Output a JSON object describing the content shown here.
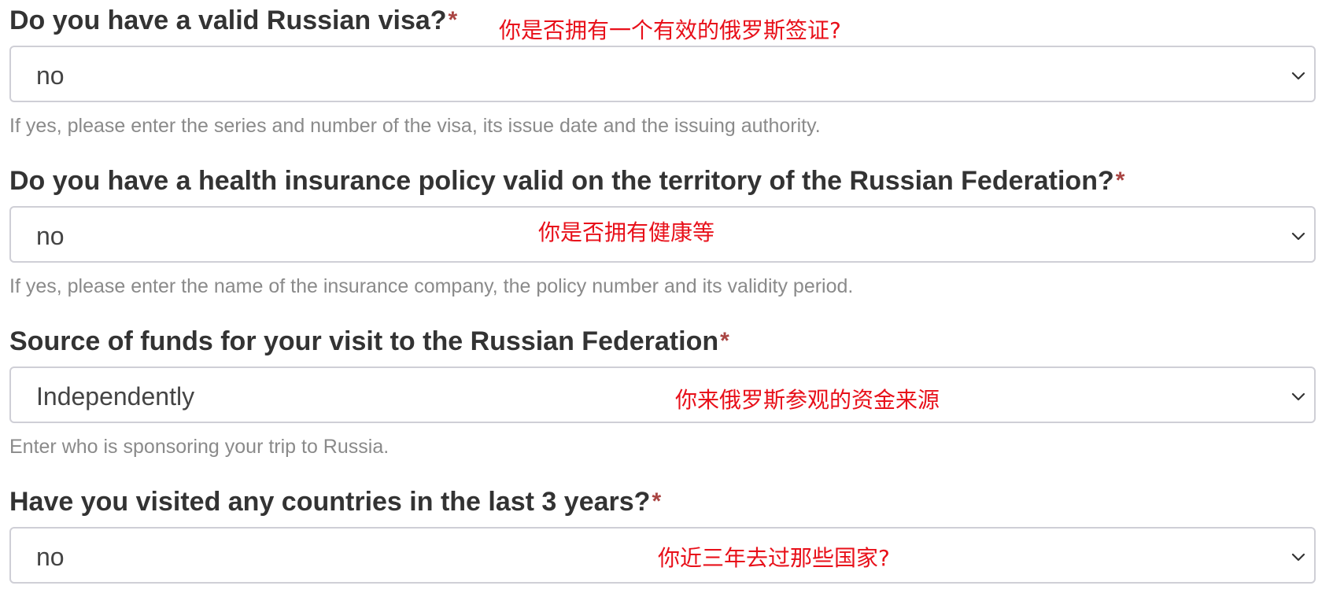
{
  "form": {
    "fields": [
      {
        "question": "Do you have a valid Russian visa?",
        "required_mark": "*",
        "selected": "no",
        "help": "If yes, please enter the series and number of the visa, its issue date and the issuing authority.",
        "annotation": "你是否拥有一个有效的俄罗斯签证?"
      },
      {
        "question": "Do you have a health insurance policy valid on the territory of the Russian Federation?",
        "required_mark": "*",
        "selected": "no",
        "help": "If yes, please enter the name of the insurance company, the policy number and its validity period.",
        "annotation": "你是否拥有健康等"
      },
      {
        "question": "Source of funds for your visit to the Russian Federation",
        "required_mark": "*",
        "selected": "Independently",
        "help": "Enter who is sponsoring your trip to Russia.",
        "annotation": "你来俄罗斯参观的资金来源"
      },
      {
        "question": "Have you visited any countries in the last 3 years?",
        "required_mark": "*",
        "selected": "no",
        "annotation": "你近三年去过那些国家?"
      }
    ]
  },
  "colors": {
    "label": "#333333",
    "required": "#a94442",
    "help_text": "#8a8a8a",
    "border": "#cfcfd6",
    "annotation": "#e8101a"
  },
  "icons": {
    "dropdown": "chevron-down-icon"
  }
}
